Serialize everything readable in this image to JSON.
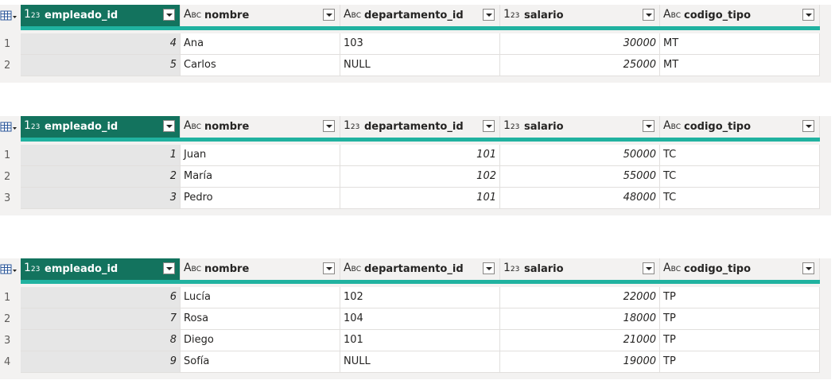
{
  "type_icons": {
    "number": "number-type-icon",
    "text": "text-type-icon",
    "table": "table-menu-icon"
  },
  "colors": {
    "selected_header": "#13735e",
    "quality_bar": "#20b2a0",
    "key_column": "#e6e6e6"
  },
  "tables": [
    {
      "columns": [
        {
          "name": "empleado_id",
          "type": "number",
          "type_glyph": "123"
        },
        {
          "name": "nombre",
          "type": "text",
          "type_glyph": "ABC"
        },
        {
          "name": "departamento_id",
          "type": "text",
          "type_glyph": "ABC"
        },
        {
          "name": "salario",
          "type": "number",
          "type_glyph": "123"
        },
        {
          "name": "codigo_tipo",
          "type": "text",
          "type_glyph": "ABC"
        }
      ],
      "rows": [
        {
          "n": "1",
          "cells": [
            "4",
            "Ana",
            "103",
            "30000",
            "MT"
          ]
        },
        {
          "n": "2",
          "cells": [
            "5",
            "Carlos",
            "NULL",
            "25000",
            "MT"
          ]
        }
      ]
    },
    {
      "columns": [
        {
          "name": "empleado_id",
          "type": "number",
          "type_glyph": "123"
        },
        {
          "name": "nombre",
          "type": "text",
          "type_glyph": "ABC"
        },
        {
          "name": "departamento_id",
          "type": "number",
          "type_glyph": "123"
        },
        {
          "name": "salario",
          "type": "number",
          "type_glyph": "123"
        },
        {
          "name": "codigo_tipo",
          "type": "text",
          "type_glyph": "ABC"
        }
      ],
      "rows": [
        {
          "n": "1",
          "cells": [
            "1",
            "Juan",
            "101",
            "50000",
            "TC"
          ]
        },
        {
          "n": "2",
          "cells": [
            "2",
            "María",
            "102",
            "55000",
            "TC"
          ]
        },
        {
          "n": "3",
          "cells": [
            "3",
            "Pedro",
            "101",
            "48000",
            "TC"
          ]
        }
      ]
    },
    {
      "columns": [
        {
          "name": "empleado_id",
          "type": "number",
          "type_glyph": "123"
        },
        {
          "name": "nombre",
          "type": "text",
          "type_glyph": "ABC"
        },
        {
          "name": "departamento_id",
          "type": "text",
          "type_glyph": "ABC"
        },
        {
          "name": "salario",
          "type": "number",
          "type_glyph": "123"
        },
        {
          "name": "codigo_tipo",
          "type": "text",
          "type_glyph": "ABC"
        }
      ],
      "rows": [
        {
          "n": "1",
          "cells": [
            "6",
            "Lucía",
            "102",
            "22000",
            "TP"
          ]
        },
        {
          "n": "2",
          "cells": [
            "7",
            "Rosa",
            "104",
            "18000",
            "TP"
          ]
        },
        {
          "n": "3",
          "cells": [
            "8",
            "Diego",
            "101",
            "21000",
            "TP"
          ]
        },
        {
          "n": "4",
          "cells": [
            "9",
            "Sofía",
            "NULL",
            "19000",
            "TP"
          ]
        }
      ]
    }
  ]
}
